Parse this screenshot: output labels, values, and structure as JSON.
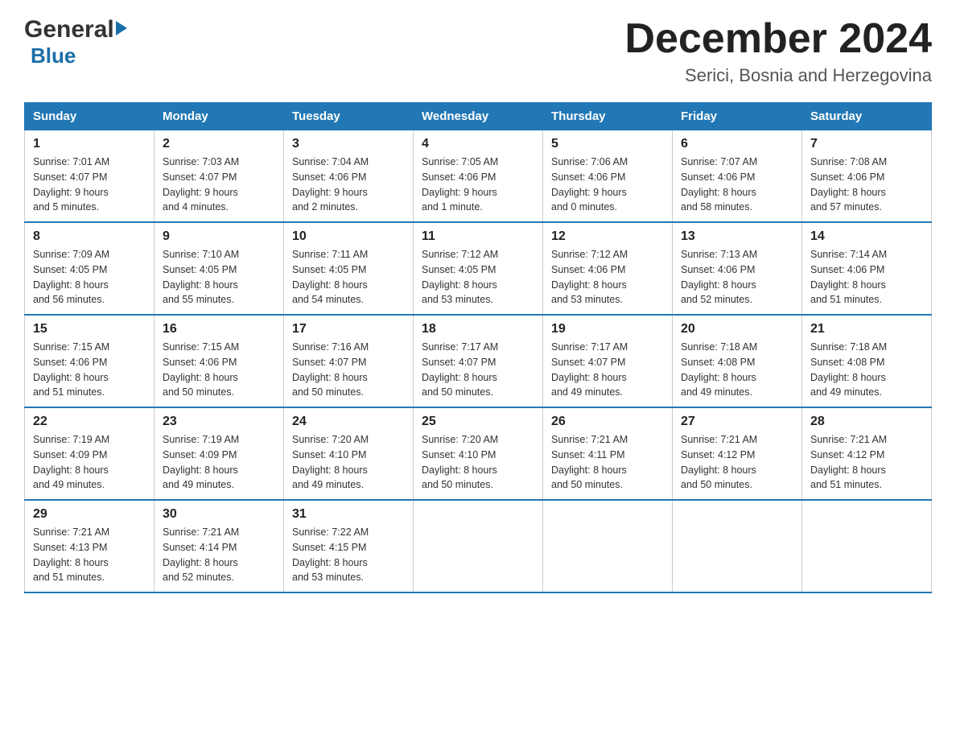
{
  "header": {
    "logo_general": "General",
    "logo_arrow": "▶",
    "logo_blue": "Blue",
    "month_title": "December 2024",
    "location": "Serici, Bosnia and Herzegovina"
  },
  "days_of_week": [
    "Sunday",
    "Monday",
    "Tuesday",
    "Wednesday",
    "Thursday",
    "Friday",
    "Saturday"
  ],
  "weeks": [
    [
      {
        "day": "1",
        "sunrise": "7:01 AM",
        "sunset": "4:07 PM",
        "daylight": "9 hours and 5 minutes."
      },
      {
        "day": "2",
        "sunrise": "7:03 AM",
        "sunset": "4:07 PM",
        "daylight": "9 hours and 4 minutes."
      },
      {
        "day": "3",
        "sunrise": "7:04 AM",
        "sunset": "4:06 PM",
        "daylight": "9 hours and 2 minutes."
      },
      {
        "day": "4",
        "sunrise": "7:05 AM",
        "sunset": "4:06 PM",
        "daylight": "9 hours and 1 minute."
      },
      {
        "day": "5",
        "sunrise": "7:06 AM",
        "sunset": "4:06 PM",
        "daylight": "9 hours and 0 minutes."
      },
      {
        "day": "6",
        "sunrise": "7:07 AM",
        "sunset": "4:06 PM",
        "daylight": "8 hours and 58 minutes."
      },
      {
        "day": "7",
        "sunrise": "7:08 AM",
        "sunset": "4:06 PM",
        "daylight": "8 hours and 57 minutes."
      }
    ],
    [
      {
        "day": "8",
        "sunrise": "7:09 AM",
        "sunset": "4:05 PM",
        "daylight": "8 hours and 56 minutes."
      },
      {
        "day": "9",
        "sunrise": "7:10 AM",
        "sunset": "4:05 PM",
        "daylight": "8 hours and 55 minutes."
      },
      {
        "day": "10",
        "sunrise": "7:11 AM",
        "sunset": "4:05 PM",
        "daylight": "8 hours and 54 minutes."
      },
      {
        "day": "11",
        "sunrise": "7:12 AM",
        "sunset": "4:05 PM",
        "daylight": "8 hours and 53 minutes."
      },
      {
        "day": "12",
        "sunrise": "7:12 AM",
        "sunset": "4:06 PM",
        "daylight": "8 hours and 53 minutes."
      },
      {
        "day": "13",
        "sunrise": "7:13 AM",
        "sunset": "4:06 PM",
        "daylight": "8 hours and 52 minutes."
      },
      {
        "day": "14",
        "sunrise": "7:14 AM",
        "sunset": "4:06 PM",
        "daylight": "8 hours and 51 minutes."
      }
    ],
    [
      {
        "day": "15",
        "sunrise": "7:15 AM",
        "sunset": "4:06 PM",
        "daylight": "8 hours and 51 minutes."
      },
      {
        "day": "16",
        "sunrise": "7:15 AM",
        "sunset": "4:06 PM",
        "daylight": "8 hours and 50 minutes."
      },
      {
        "day": "17",
        "sunrise": "7:16 AM",
        "sunset": "4:07 PM",
        "daylight": "8 hours and 50 minutes."
      },
      {
        "day": "18",
        "sunrise": "7:17 AM",
        "sunset": "4:07 PM",
        "daylight": "8 hours and 50 minutes."
      },
      {
        "day": "19",
        "sunrise": "7:17 AM",
        "sunset": "4:07 PM",
        "daylight": "8 hours and 49 minutes."
      },
      {
        "day": "20",
        "sunrise": "7:18 AM",
        "sunset": "4:08 PM",
        "daylight": "8 hours and 49 minutes."
      },
      {
        "day": "21",
        "sunrise": "7:18 AM",
        "sunset": "4:08 PM",
        "daylight": "8 hours and 49 minutes."
      }
    ],
    [
      {
        "day": "22",
        "sunrise": "7:19 AM",
        "sunset": "4:09 PM",
        "daylight": "8 hours and 49 minutes."
      },
      {
        "day": "23",
        "sunrise": "7:19 AM",
        "sunset": "4:09 PM",
        "daylight": "8 hours and 49 minutes."
      },
      {
        "day": "24",
        "sunrise": "7:20 AM",
        "sunset": "4:10 PM",
        "daylight": "8 hours and 49 minutes."
      },
      {
        "day": "25",
        "sunrise": "7:20 AM",
        "sunset": "4:10 PM",
        "daylight": "8 hours and 50 minutes."
      },
      {
        "day": "26",
        "sunrise": "7:21 AM",
        "sunset": "4:11 PM",
        "daylight": "8 hours and 50 minutes."
      },
      {
        "day": "27",
        "sunrise": "7:21 AM",
        "sunset": "4:12 PM",
        "daylight": "8 hours and 50 minutes."
      },
      {
        "day": "28",
        "sunrise": "7:21 AM",
        "sunset": "4:12 PM",
        "daylight": "8 hours and 51 minutes."
      }
    ],
    [
      {
        "day": "29",
        "sunrise": "7:21 AM",
        "sunset": "4:13 PM",
        "daylight": "8 hours and 51 minutes."
      },
      {
        "day": "30",
        "sunrise": "7:21 AM",
        "sunset": "4:14 PM",
        "daylight": "8 hours and 52 minutes."
      },
      {
        "day": "31",
        "sunrise": "7:22 AM",
        "sunset": "4:15 PM",
        "daylight": "8 hours and 53 minutes."
      },
      null,
      null,
      null,
      null
    ]
  ],
  "labels": {
    "sunrise": "Sunrise:",
    "sunset": "Sunset:",
    "daylight": "Daylight:"
  }
}
